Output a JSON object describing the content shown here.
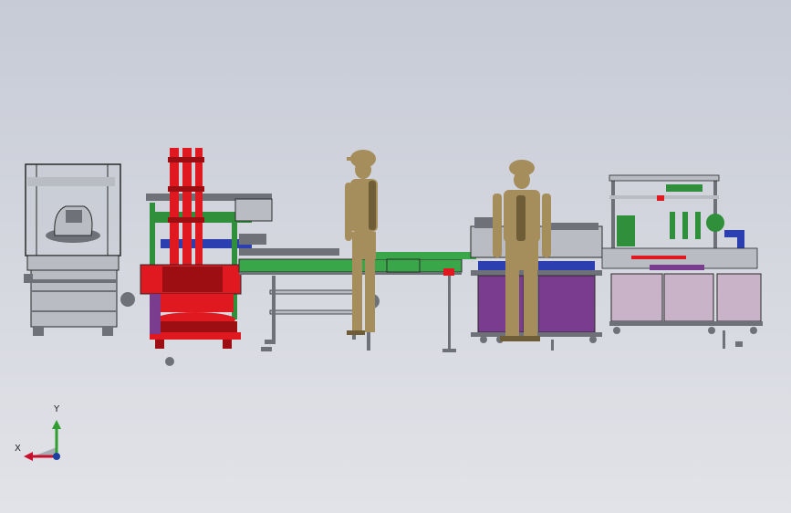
{
  "scene": {
    "background_top": "#c7cbd6",
    "background_bottom": "#e2e3e8",
    "colors": {
      "steel": "#b9bcc2",
      "steel_dark": "#6e7178",
      "outline": "#2a2a2a",
      "robot_red": "#e01820",
      "robot_red_dark": "#9c0e12",
      "conveyor_green": "#3aa64a",
      "frame_green": "#2f8f3a",
      "purple_cabinet": "#7a3c8f",
      "pink_cabinet": "#c9b3c9",
      "figure_bronze": "#a58e5c",
      "figure_shadow": "#6f5d38",
      "blue_part": "#2c3fb0"
    }
  },
  "axis_triad": {
    "y_label": "Y",
    "x_label": "X",
    "y_color": "#2e9e2e",
    "x_color": "#c8102e",
    "z_color": "#1d3fa0"
  }
}
